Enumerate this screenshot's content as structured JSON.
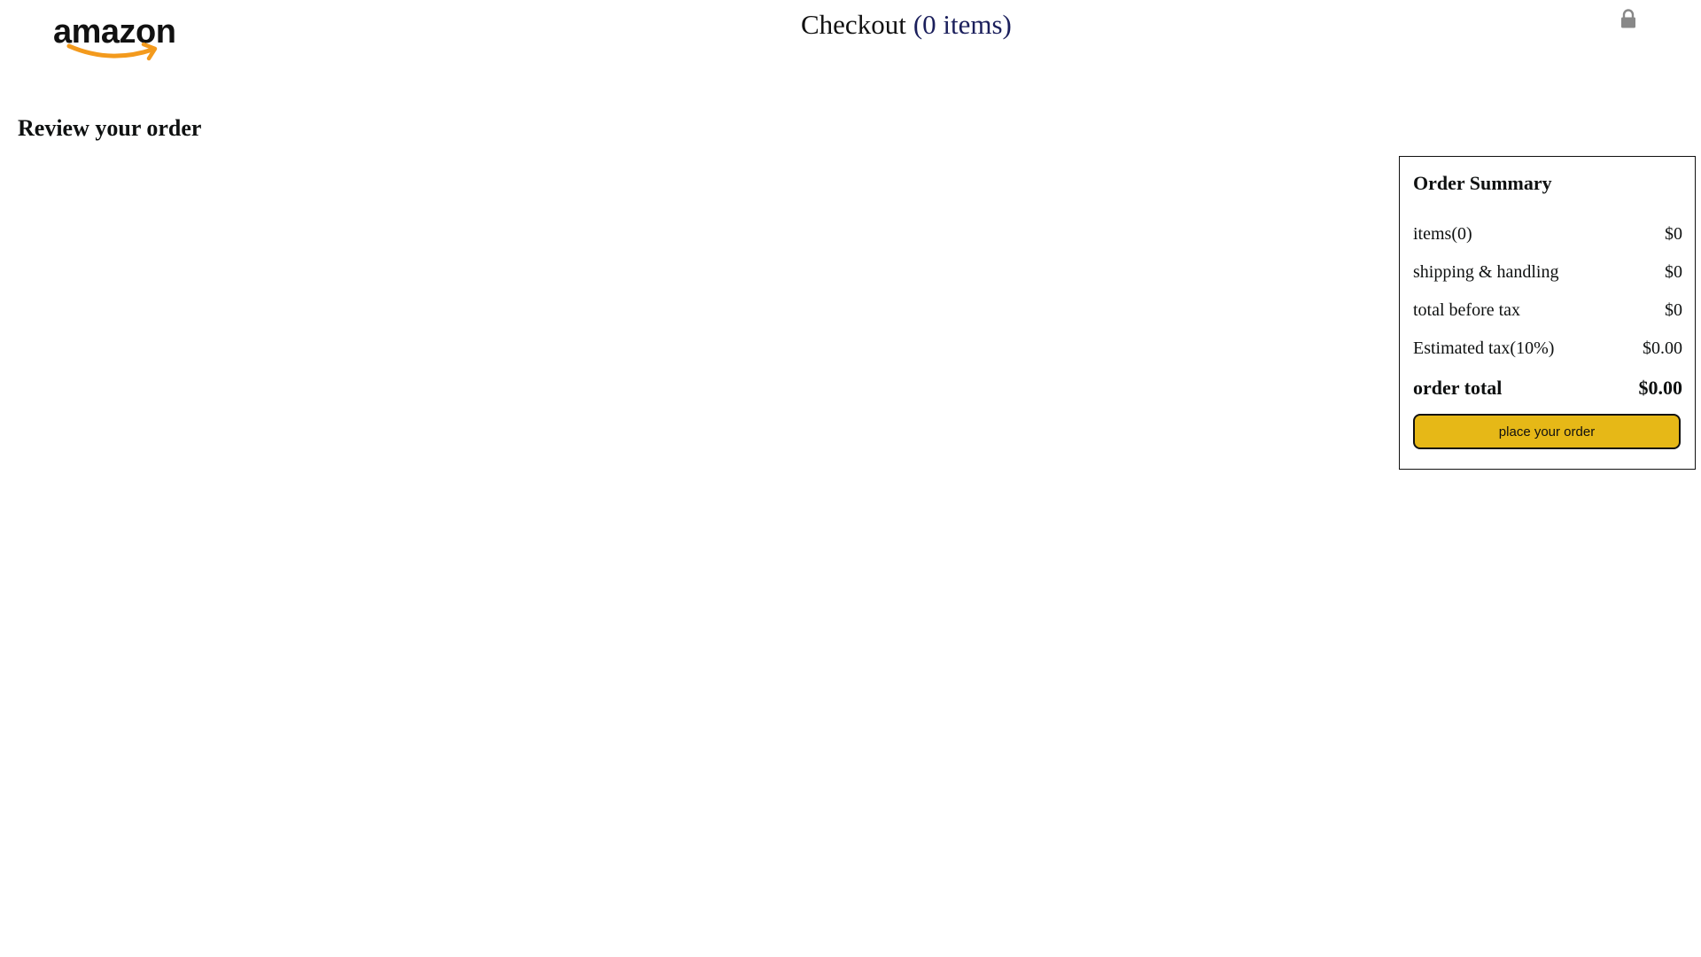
{
  "header": {
    "logo_text": "amazon",
    "checkout_word": "Checkout",
    "item_count_text": "(0 items)",
    "lock_icon": "lock-icon"
  },
  "main": {
    "heading": "Review your order"
  },
  "order_summary": {
    "title": "Order Summary",
    "rows": [
      {
        "label": "items(0)",
        "value": "$0"
      },
      {
        "label": "shipping & handling",
        "value": "$0"
      },
      {
        "label": "total before tax",
        "value": "$0"
      },
      {
        "label": "Estimated tax(10%)",
        "value": "$0.00"
      }
    ],
    "total": {
      "label": "order total",
      "value": "$0.00"
    },
    "button_label": "place your order"
  },
  "colors": {
    "button_bg": "#e6b817",
    "item_count": "#1b1f5c",
    "logo_smile": "#f39a1d",
    "lock_icon": "#888888"
  }
}
